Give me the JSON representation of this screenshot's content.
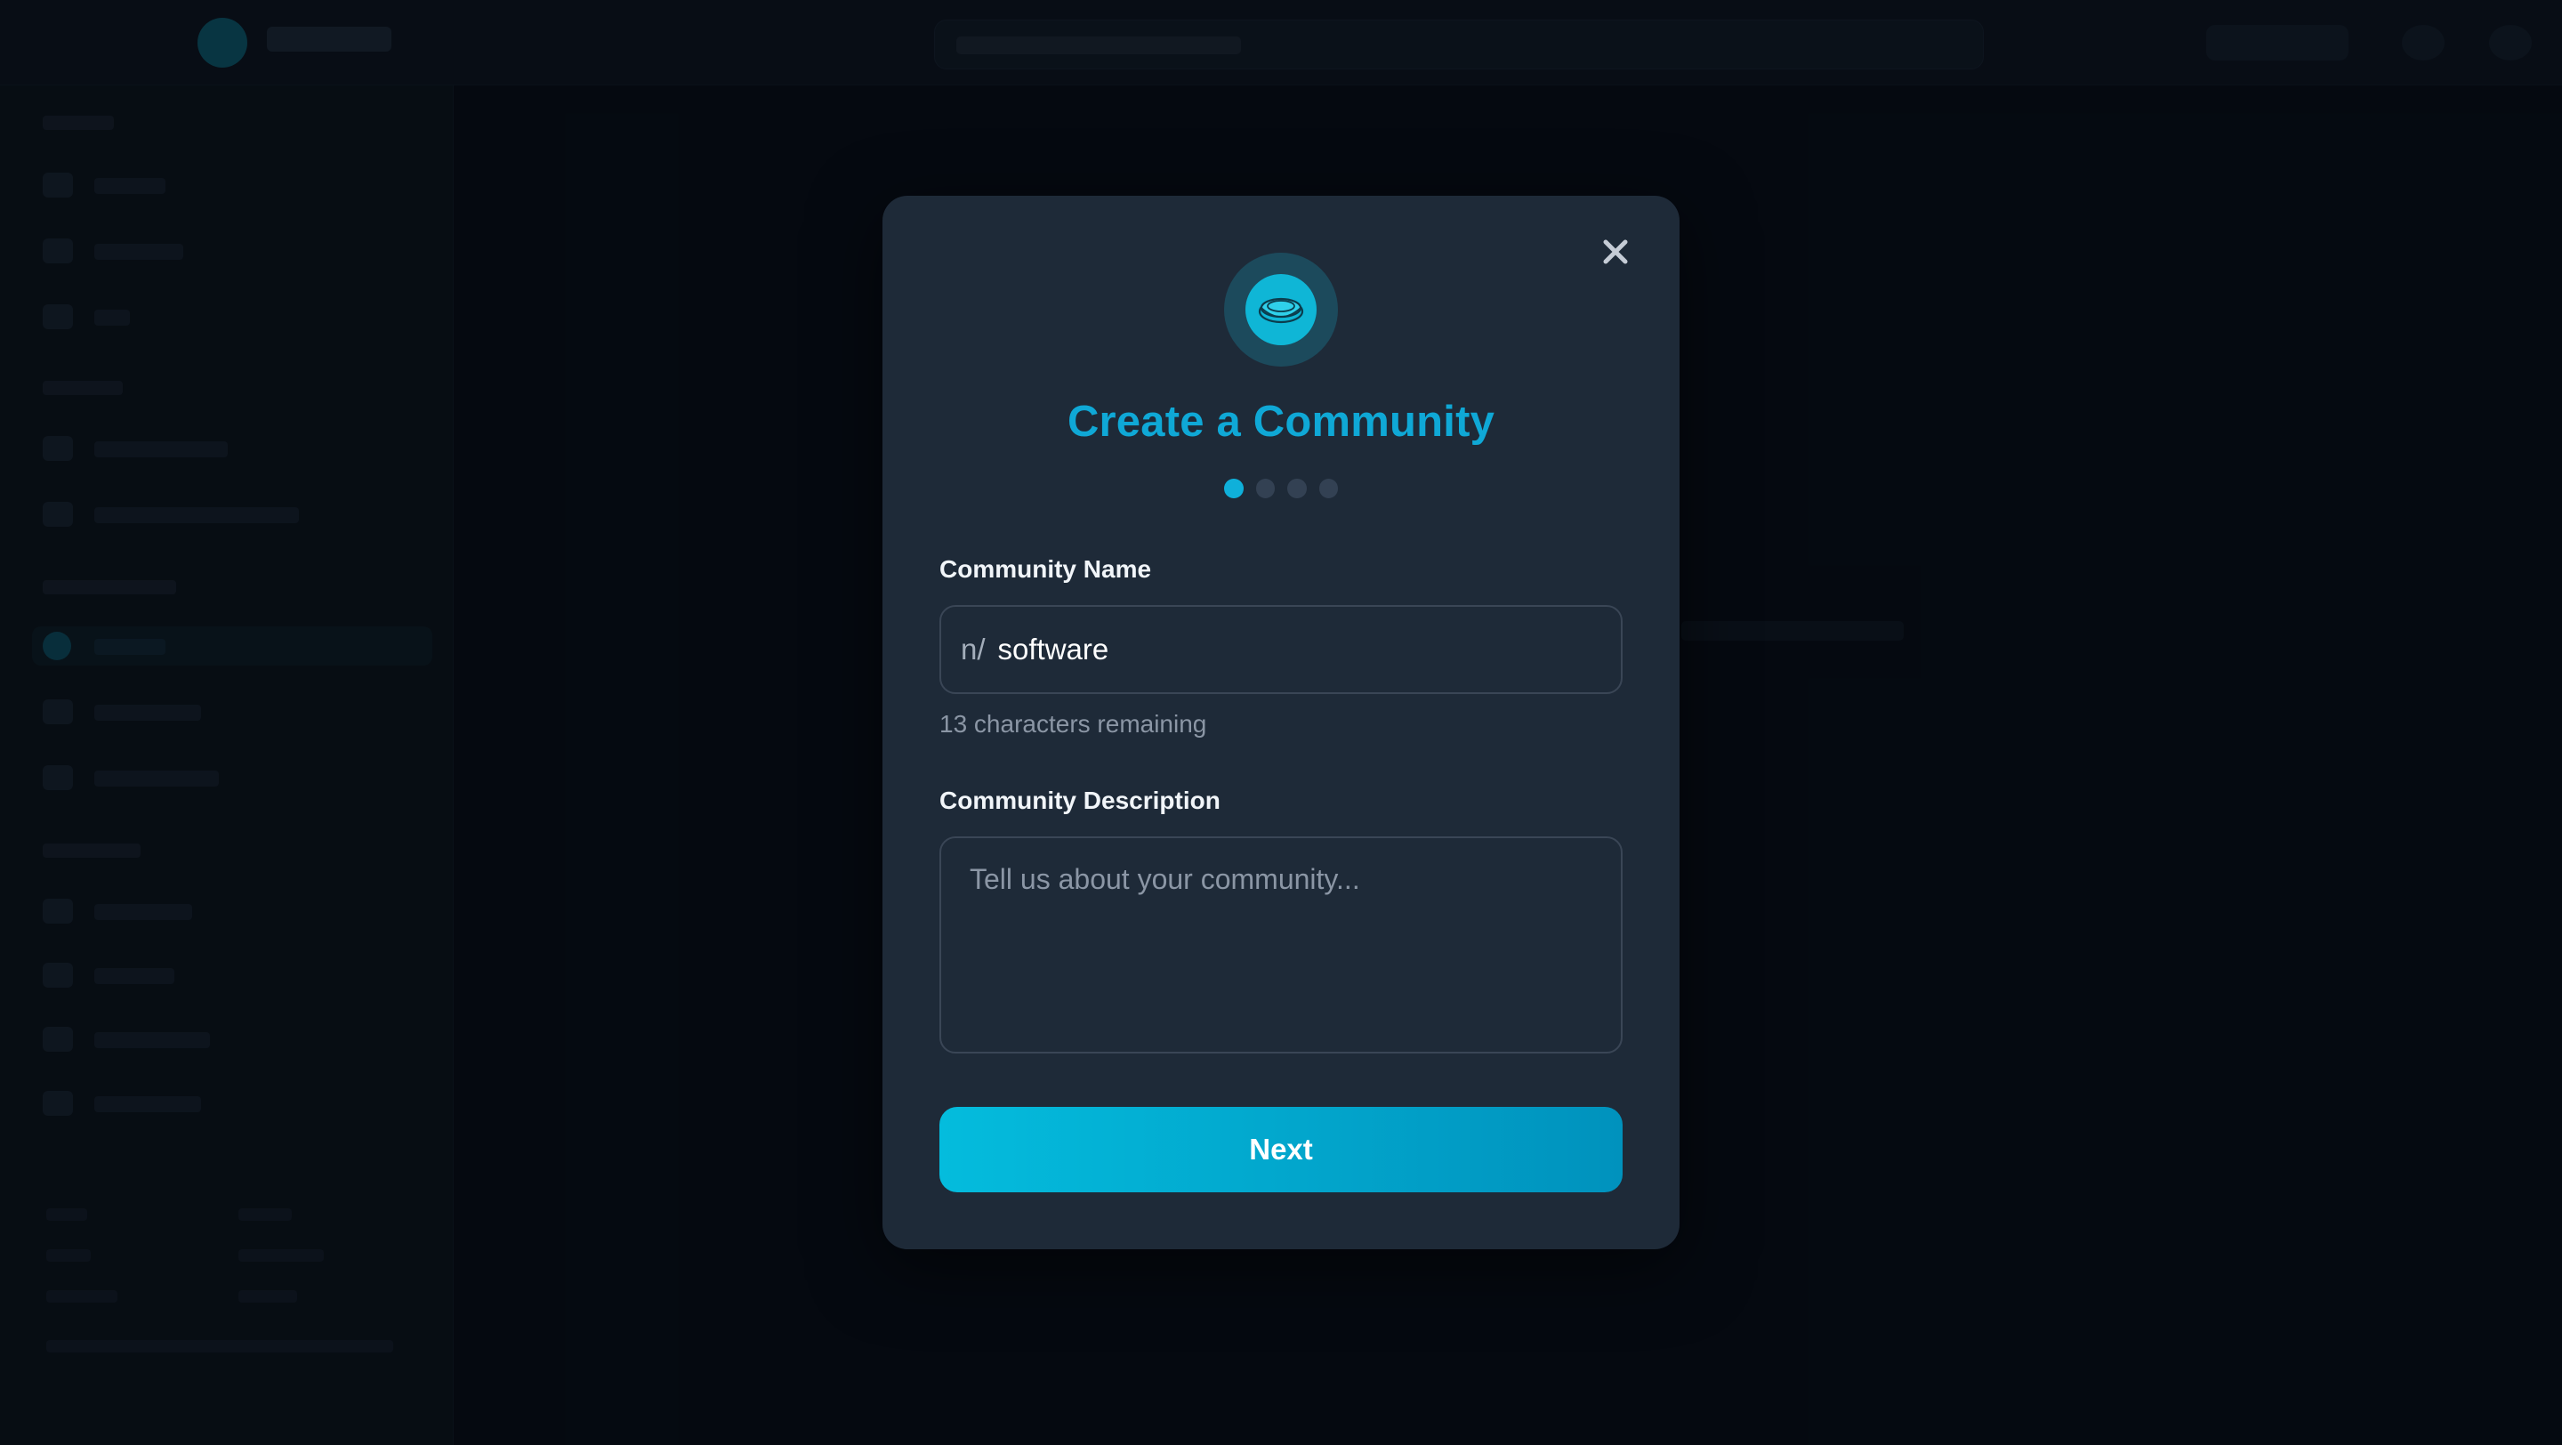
{
  "modal": {
    "title": "Create a Community",
    "close_icon": "close-icon",
    "hero_icon": "community-disc-icon",
    "steps": {
      "total": 4,
      "current": 1
    },
    "name_field": {
      "label": "Community Name",
      "prefix": "n/",
      "value": "software",
      "helper": "13 characters remaining"
    },
    "description_field": {
      "label": "Community Description",
      "placeholder": "Tell us about your community...",
      "value": ""
    },
    "next_label": "Next"
  },
  "colors": {
    "accent": "#0fa8d6",
    "modal_bg": "#1e2a38",
    "button_gradient_start": "#04bcdd",
    "button_gradient_end": "#0092bd"
  }
}
